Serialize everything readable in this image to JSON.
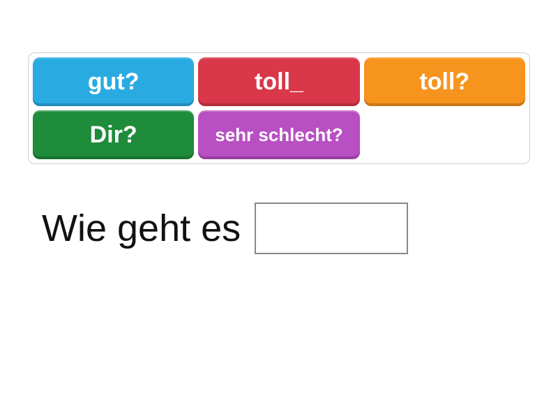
{
  "word_bank": {
    "tiles": [
      {
        "label": "gut?",
        "color": "blue"
      },
      {
        "label": "toll_",
        "color": "red"
      },
      {
        "label": "toll?",
        "color": "orange"
      },
      {
        "label": "Dir?",
        "color": "green"
      },
      {
        "label": "sehr schlecht?",
        "color": "purple",
        "small": true
      }
    ]
  },
  "sentence": {
    "prefix": "Wie geht es",
    "blank_value": ""
  }
}
